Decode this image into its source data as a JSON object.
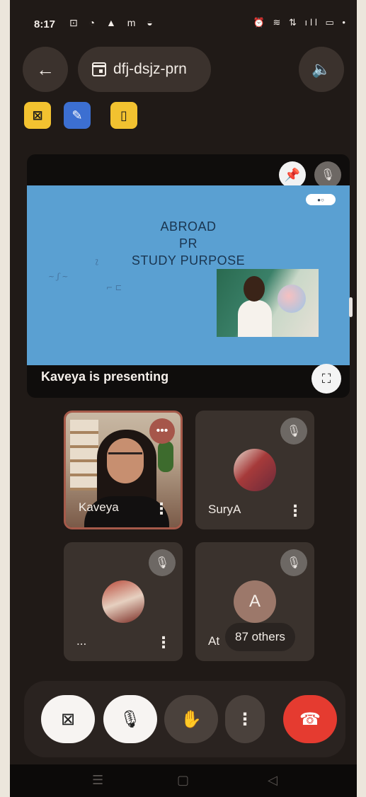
{
  "status_bar": {
    "time": "8:17",
    "left_icons": "⊡ ◔ ▲ m ◒",
    "right_icons": "⏰ ≋ ⇅ ıll ▭ •"
  },
  "top_bar": {
    "meeting_code": "dfj-dsjz-prn",
    "back_icon": "←",
    "sound_icon": "🔈",
    "calendar_icon": "calendar-icon"
  },
  "indicators": [
    {
      "name": "camera-off-indicator",
      "glyph": "⊠"
    },
    {
      "name": "edit-indicator",
      "glyph": "✎"
    },
    {
      "name": "door-indicator",
      "glyph": "▯"
    }
  ],
  "presentation": {
    "slide_lines": [
      "ABROAD",
      "PR",
      "STUDY PURPOSE"
    ],
    "presenter_label": "Kaveya is presenting",
    "pin_icon": "📌",
    "mic_off_icon": "🎙",
    "expand_icon": "⛶"
  },
  "participants": [
    {
      "name": "Kaveya",
      "more": "⋮",
      "speaking_icon": "•••"
    },
    {
      "name": "SuryA",
      "more": "⋮",
      "mic_off_icon": "🎙"
    },
    {
      "name": "...",
      "more": "⋮",
      "mic_off_icon": "🎙"
    },
    {
      "name": "At",
      "avatar_letter": "A",
      "others_label": "87 others",
      "mic_off_icon": "🎙"
    }
  ],
  "controls": {
    "camera_icon": "⊠",
    "mic_icon": "🎙",
    "hand_icon": "✋",
    "more_icon": "⋮",
    "end_icon": "☎"
  },
  "nav_bar": {
    "recents": "☰",
    "home": "▢",
    "back": "◁"
  }
}
